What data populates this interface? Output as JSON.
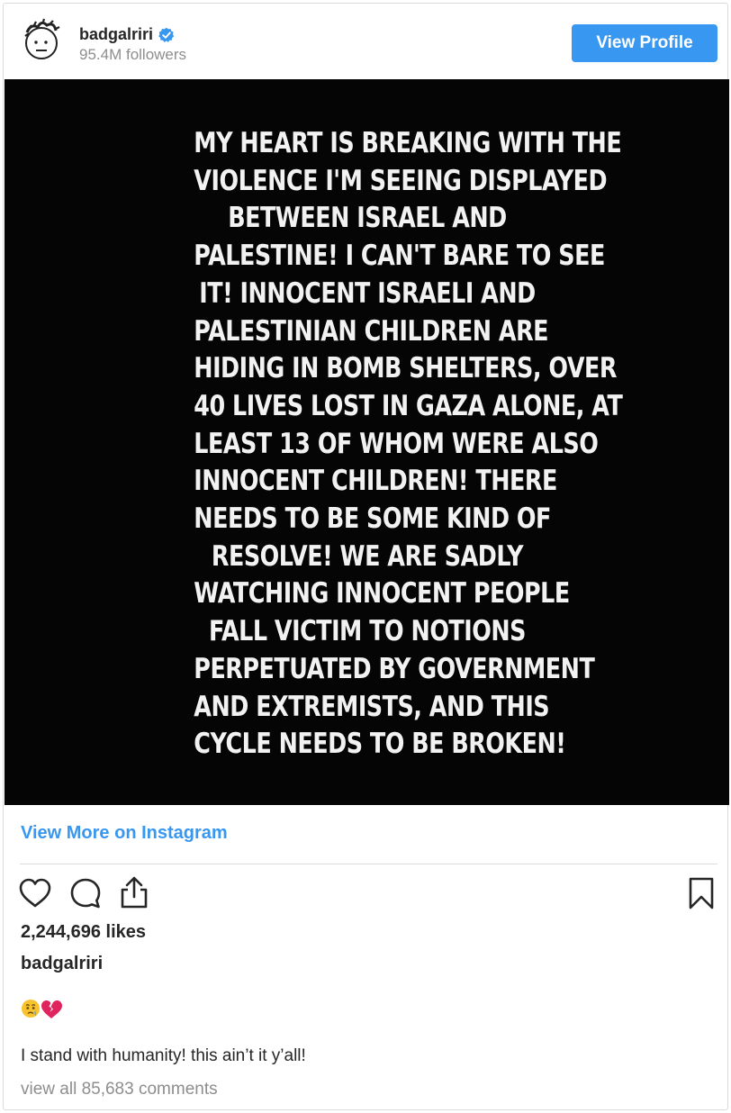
{
  "header": {
    "username": "badgalriri",
    "followers": "95.4M followers",
    "view_profile_label": "View Profile"
  },
  "media": {
    "text_lines": [
      "MY HEART IS BREAKING WITH THE",
      "VIOLENCE I'M SEEING DISPLAYED",
      "BETWEEN ISRAEL AND",
      "PALESTINE! I CAN'T BARE TO SEE",
      "IT! INNOCENT ISRAELI AND",
      "PALESTINIAN CHILDREN ARE",
      "HIDING IN BOMB SHELTERS, OVER",
      "40 LIVES LOST IN GAZA ALONE, AT",
      "LEAST 13 OF WHOM WERE ALSO",
      "INNOCENT CHILDREN! THERE",
      "NEEDS TO BE SOME KIND OF",
      "RESOLVE! WE ARE SADLY",
      "WATCHING INNOCENT PEOPLE",
      "FALL VICTIM TO NOTIONS",
      "PERPETUATED BY GOVERNMENT",
      "AND EXTREMISTS, AND THIS",
      "CYCLE NEEDS TO BE BROKEN!"
    ]
  },
  "footer": {
    "view_more_label": "View More on Instagram",
    "likes": "2,244,696 likes",
    "caption_username": "badgalriri",
    "emoji_caption": "😢💔",
    "caption_text": "I stand with humanity! this ain’t it y’all!",
    "view_comments": "view all 85,683 comments"
  },
  "icons": {
    "avatar": "avatar-doodle-icon",
    "verified": "verified-badge-icon",
    "like": "heart-icon",
    "comment": "comment-icon",
    "share": "share-icon",
    "save": "bookmark-icon"
  },
  "colors": {
    "accent": "#3897f0",
    "text": "#262626",
    "muted": "#8e8e8e",
    "media_bg": "#050505",
    "media_text": "#f2f2f2"
  }
}
